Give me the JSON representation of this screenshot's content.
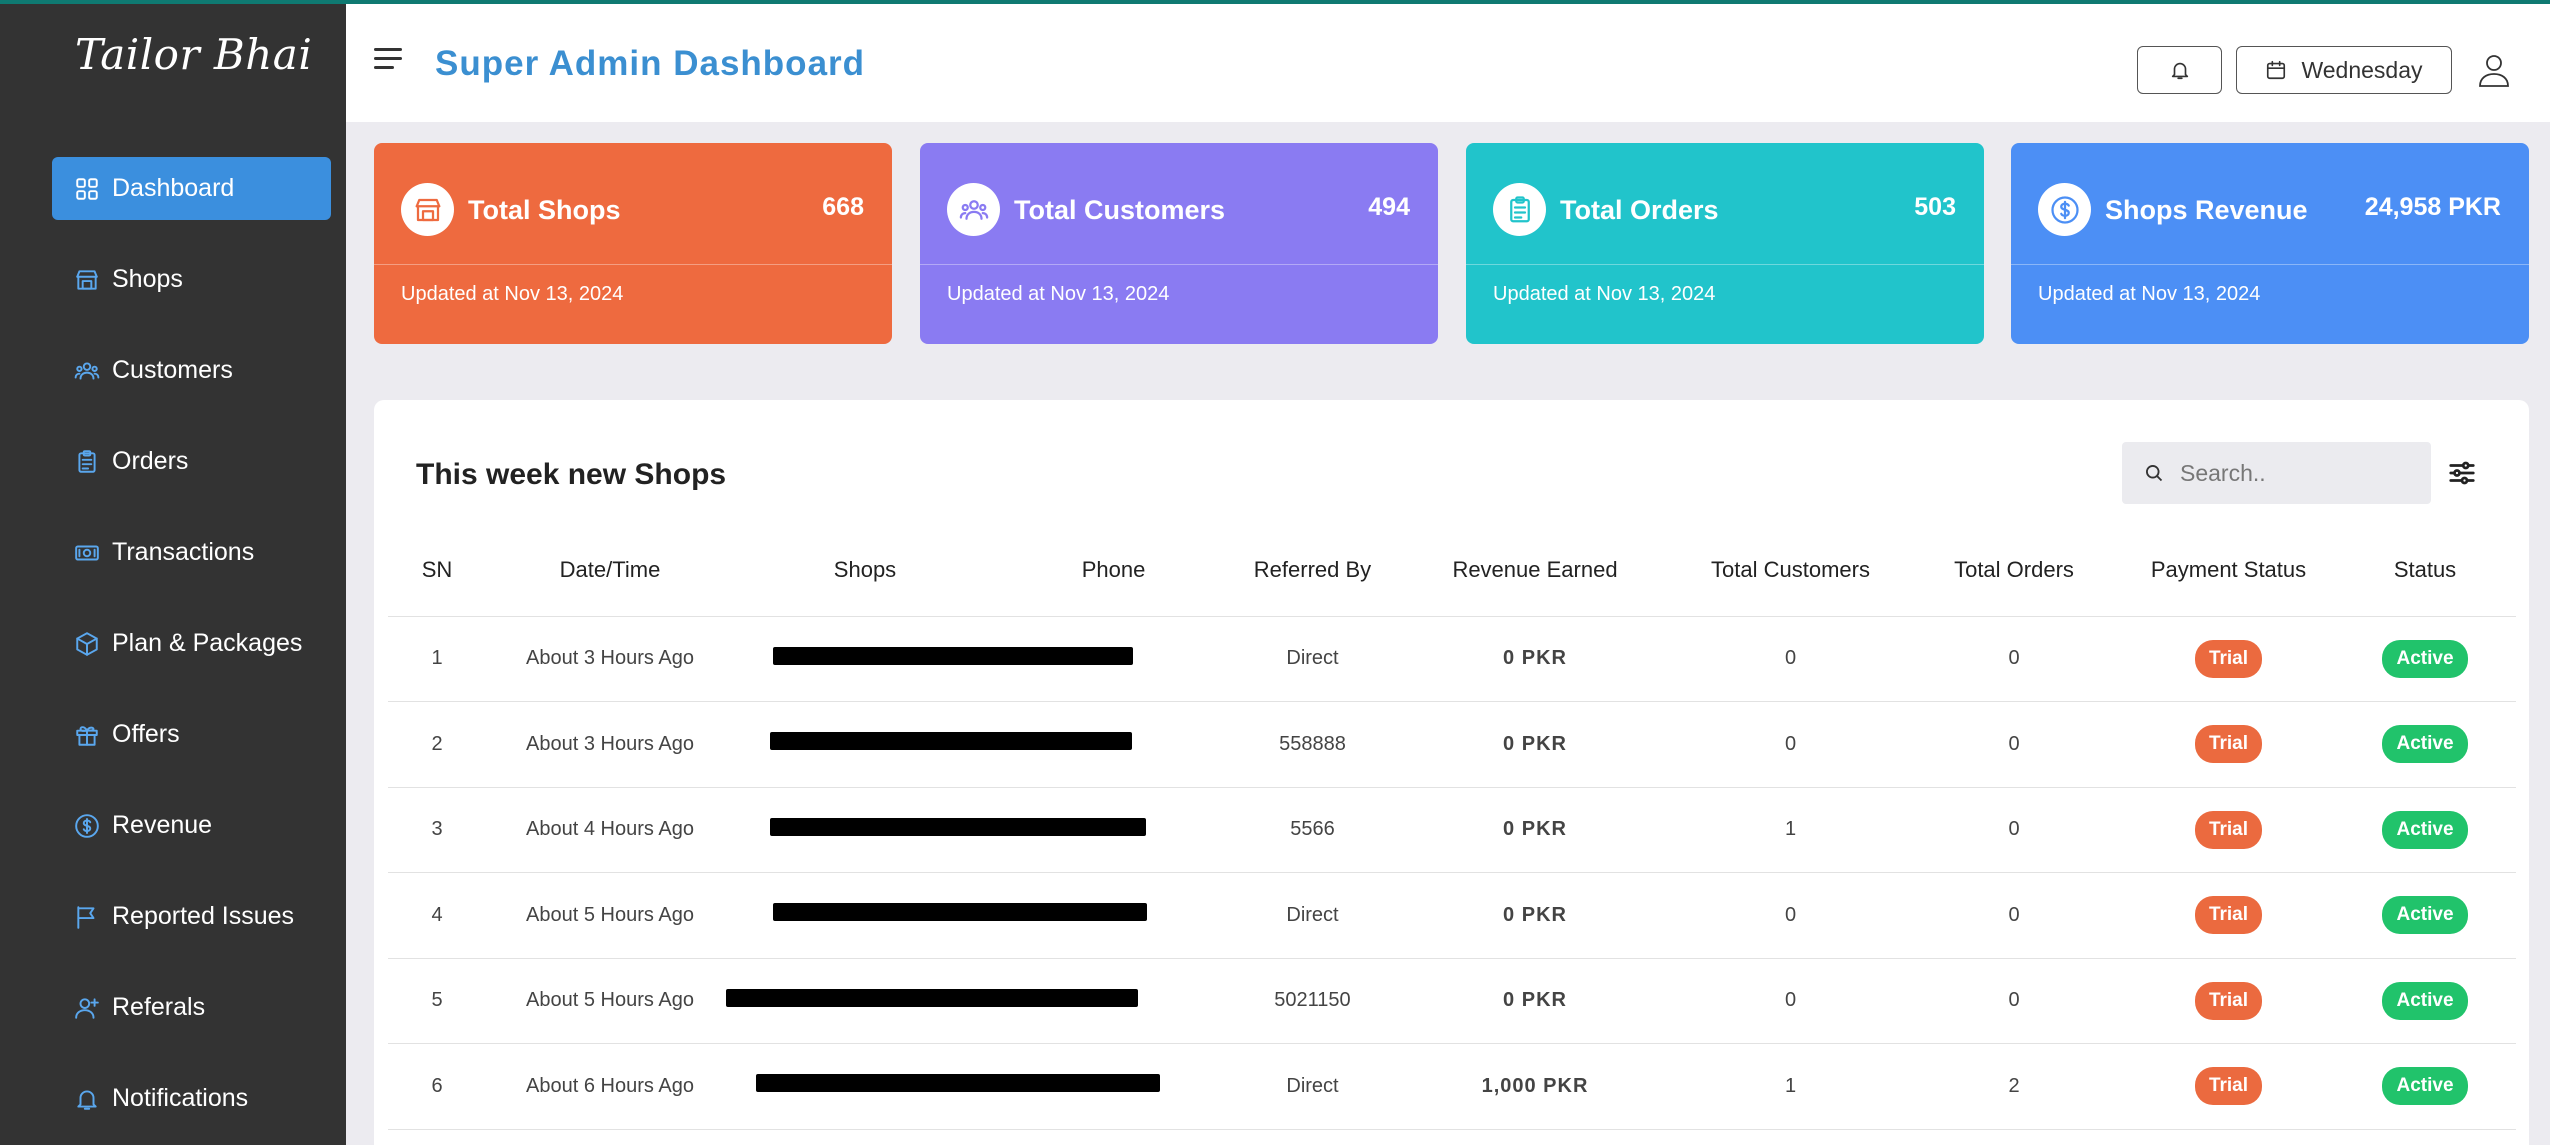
{
  "sidebar": {
    "brand": "Tailor Bhai",
    "items": [
      {
        "label": "Dashboard",
        "icon": "grid-icon",
        "active": true
      },
      {
        "label": "Shops",
        "icon": "store-icon"
      },
      {
        "label": "Customers",
        "icon": "users-icon"
      },
      {
        "label": "Orders",
        "icon": "clipboard-icon"
      },
      {
        "label": "Transactions",
        "icon": "money-icon"
      },
      {
        "label": "Plan & Packages",
        "icon": "package-icon"
      },
      {
        "label": "Offers",
        "icon": "gift-icon"
      },
      {
        "label": "Revenue",
        "icon": "dollar-icon"
      },
      {
        "label": "Reported Issues",
        "icon": "flag-icon"
      },
      {
        "label": "Referals",
        "icon": "user-plus-icon"
      },
      {
        "label": "Notifications",
        "icon": "bell-icon"
      }
    ]
  },
  "header": {
    "title": "Super Admin Dashboard",
    "day": "Wednesday"
  },
  "cards": [
    {
      "title": "Total Shops",
      "value": "668",
      "updated": "Updated at Nov 13, 2024",
      "color": "#ee6a3f",
      "icon": "store-icon"
    },
    {
      "title": "Total Customers",
      "value": "494",
      "updated": "Updated at Nov 13, 2024",
      "color": "#8a7bf2",
      "icon": "users-icon"
    },
    {
      "title": "Total Orders",
      "value": "503",
      "updated": "Updated at Nov 13, 2024",
      "color": "#21c4cb",
      "icon": "clipboard-icon"
    },
    {
      "title": "Shops Revenue",
      "value": "24,958 PKR",
      "updated": "Updated at Nov 13, 2024",
      "color": "#4c8ff5",
      "icon": "dollar-icon"
    }
  ],
  "table": {
    "title": "This week new Shops",
    "search_placeholder": "Search..",
    "columns": [
      "SN",
      "Date/Time",
      "Shops",
      "Phone",
      "Referred By",
      "Revenue Earned",
      "Total Customers",
      "Total Orders",
      "Payment Status",
      "Status"
    ],
    "rows": [
      {
        "sn": "1",
        "date": "About 3 Hours Ago",
        "referred": "Direct",
        "revenue": "0 PKR",
        "customers": "0",
        "orders": "0",
        "payment": "Trial",
        "status": "Active"
      },
      {
        "sn": "2",
        "date": "About 3 Hours Ago",
        "referred": "558888",
        "revenue": "0 PKR",
        "customers": "0",
        "orders": "0",
        "payment": "Trial",
        "status": "Active"
      },
      {
        "sn": "3",
        "date": "About 4 Hours Ago",
        "referred": "5566",
        "revenue": "0 PKR",
        "customers": "1",
        "orders": "0",
        "payment": "Trial",
        "status": "Active"
      },
      {
        "sn": "4",
        "date": "About 5 Hours Ago",
        "referred": "Direct",
        "revenue": "0 PKR",
        "customers": "0",
        "orders": "0",
        "payment": "Trial",
        "status": "Active"
      },
      {
        "sn": "5",
        "date": "About 5 Hours Ago",
        "referred": "5021150",
        "revenue": "0 PKR",
        "customers": "0",
        "orders": "0",
        "payment": "Trial",
        "status": "Active"
      },
      {
        "sn": "6",
        "date": "About 6 Hours Ago",
        "referred": "Direct",
        "revenue": "1,000 PKR",
        "customers": "1",
        "orders": "2",
        "payment": "Trial",
        "status": "Active"
      }
    ]
  }
}
